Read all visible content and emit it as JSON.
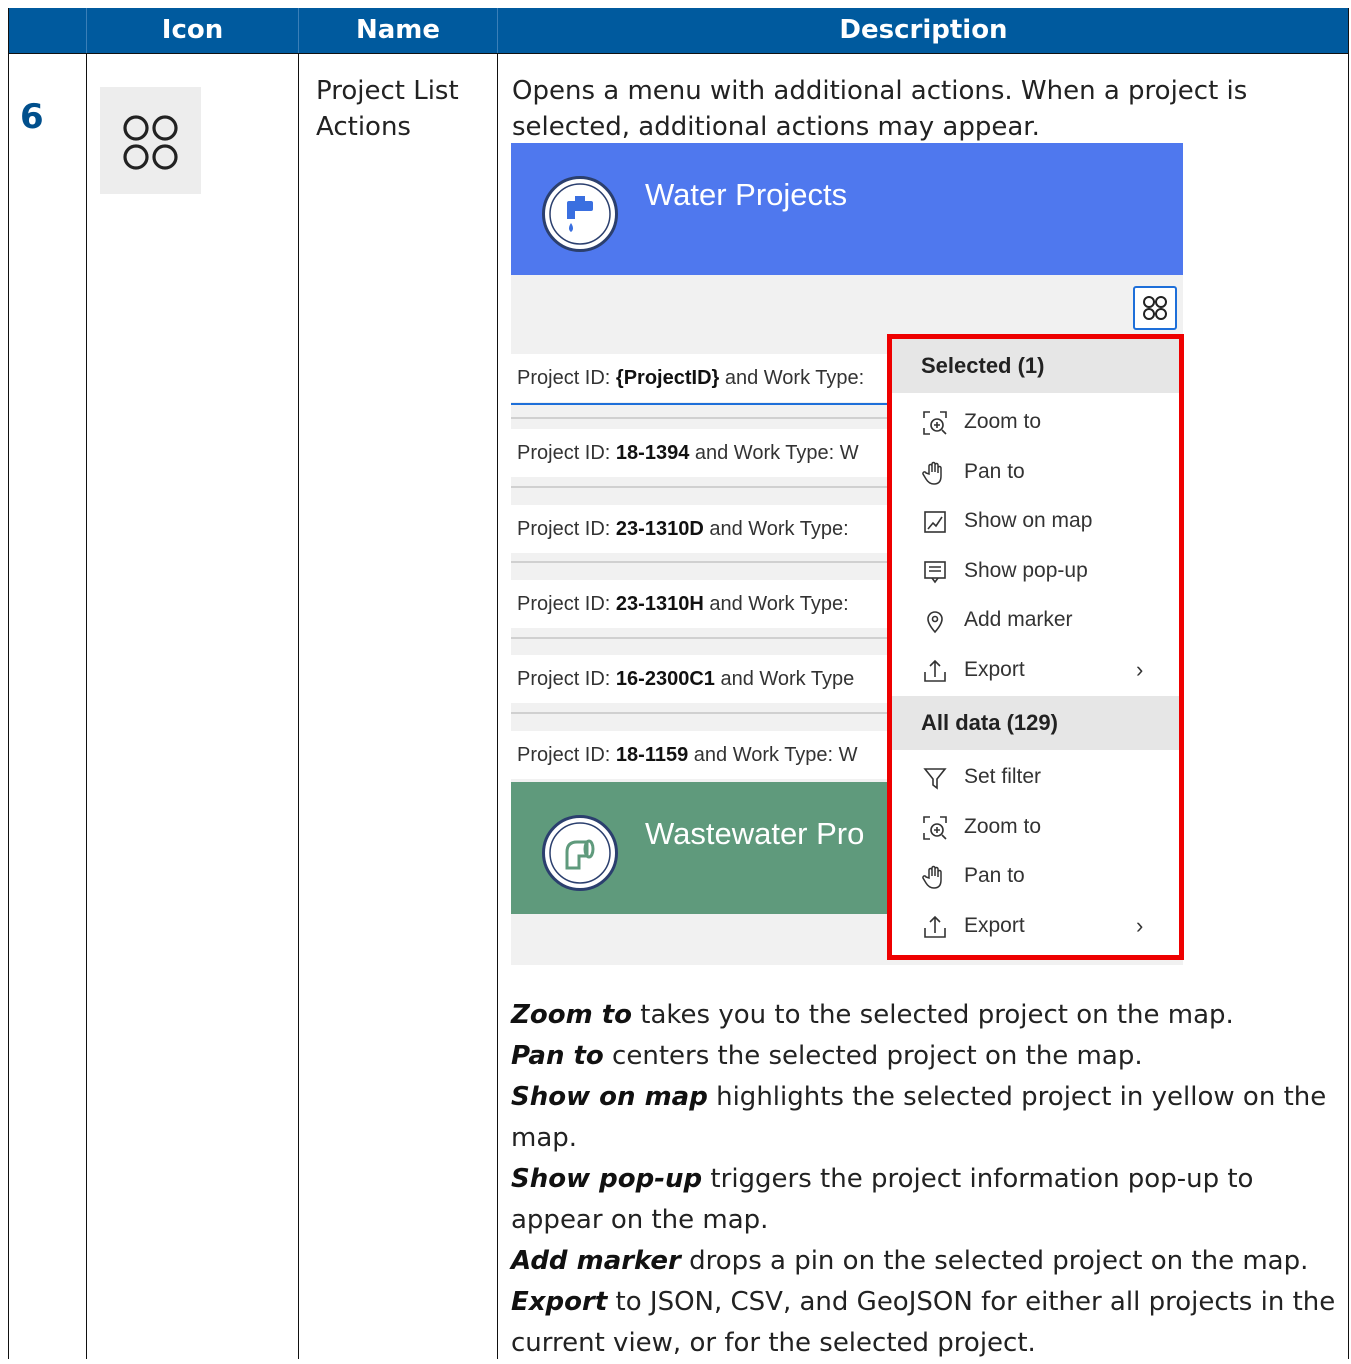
{
  "header": {
    "col_icon": "Icon",
    "col_name": "Name",
    "col_description": "Description"
  },
  "row": {
    "number": "6",
    "icon": "four-circles-grid-icon",
    "name": "Project List Actions",
    "description": "Opens a menu with additional actions. When a project is selected, additional actions may appear."
  },
  "screenshot": {
    "water_title": "Water Projects",
    "wastewater_title": "Wastewater Pro",
    "rows": [
      {
        "prefix": "Project ID: ",
        "id": "{ProjectID}",
        "suffix": " and Work Type:"
      },
      {
        "prefix": "Project ID: ",
        "id": "18-1394",
        "suffix": " and Work Type: W"
      },
      {
        "prefix": "Project ID: ",
        "id": "23-1310D",
        "suffix": " and Work Type:"
      },
      {
        "prefix": "Project ID: ",
        "id": "23-1310H",
        "suffix": " and Work Type:"
      },
      {
        "prefix": "Project ID: ",
        "id": "16-2300C1",
        "suffix": " and Work Type"
      },
      {
        "prefix": "Project ID: ",
        "id": "18-1159",
        "suffix": " and Work Type: W"
      }
    ],
    "menu": {
      "selected_header": "Selected (1)",
      "selected_items": [
        {
          "label": "Zoom to",
          "icon": "zoom-to-icon"
        },
        {
          "label": "Pan to",
          "icon": "hand-pan-icon"
        },
        {
          "label": "Show on map",
          "icon": "show-on-map-icon"
        },
        {
          "label": "Show pop-up",
          "icon": "popup-icon"
        },
        {
          "label": "Add marker",
          "icon": "marker-pin-icon"
        },
        {
          "label": "Export",
          "icon": "export-icon",
          "chevron": "›"
        }
      ],
      "all_header": "All data (129)",
      "all_items": [
        {
          "label": "Set filter",
          "icon": "filter-icon"
        },
        {
          "label": "Zoom to",
          "icon": "zoom-to-icon"
        },
        {
          "label": "Pan to",
          "icon": "hand-pan-icon"
        },
        {
          "label": "Export",
          "icon": "export-icon",
          "chevron": "›"
        }
      ]
    }
  },
  "explanations": [
    {
      "term": "Zoom to",
      "text": " takes you to the selected project on the map."
    },
    {
      "term": "Pan to",
      "text": " centers the selected project on the map."
    },
    {
      "term": "Show on map",
      "text": " highlights the selected project in yellow on the map."
    },
    {
      "term": "Show pop-up",
      "text": " triggers the project information pop-up to appear on the map."
    },
    {
      "term": "Add marker",
      "text": " drops a pin on the selected project on the map."
    },
    {
      "term": "Export",
      "text": " to JSON, CSV, and GeoJSON for either all projects in the current view, or for the selected project."
    }
  ],
  "colors": {
    "header_bg": "#005a9e",
    "row_number": "#004f8c",
    "water_banner": "#4f78ee",
    "wastewater_banner": "#5f9a7c",
    "highlight_frame": "#ee0000"
  }
}
